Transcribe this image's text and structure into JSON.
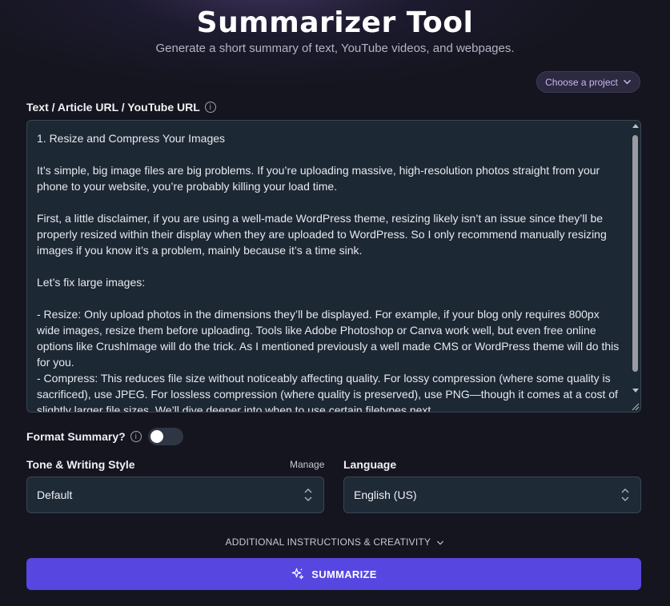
{
  "header": {
    "title": "Summarizer Tool",
    "subtitle": "Generate a short summary of text, YouTube videos, and webpages."
  },
  "project": {
    "label": "Choose a project",
    "icon": "chevron-down-icon"
  },
  "input": {
    "label": "Text / Article URL / YouTube URL",
    "info_icon": "info-icon",
    "value": "1. Resize and Compress Your Images\n\nIt’s simple, big image files are big problems. If you’re uploading massive, high-resolution photos straight from your phone to your website, you’re probably killing your load time.\n\nFirst, a little disclaimer, if you are using a well-made WordPress theme, resizing likely isn’t an issue since they’ll be properly resized within their display when they are uploaded to WordPress. So I only recommend manually resizing images if you know it’s a problem, mainly because it’s a time sink.\n\nLet’s fix large images:\n\n- Resize: Only upload photos in the dimensions they’ll be displayed. For example, if your blog only requires 800px wide images, resize them before uploading. Tools like Adobe Photoshop or Canva work well, but even free online options like CrushImage will do the trick. As I mentioned previously a well made CMS or WordPress theme will do this for you.\n- Compress: This reduces file size without noticeably affecting quality. For lossy compression (where some quality is sacrificed), use JPEG. For lossless compression (where quality is preserved), use PNG—though it comes at a cost of slightly larger file sizes. We’ll dive deeper into when to use certain filetypes next."
  },
  "format": {
    "label": "Format Summary?",
    "enabled": false
  },
  "tone": {
    "label": "Tone & Writing Style",
    "manage_label": "Manage",
    "value": "Default"
  },
  "language": {
    "label": "Language",
    "value": "English (US)"
  },
  "additional": {
    "label": "ADDITIONAL INSTRUCTIONS & CREATIVITY",
    "icon": "chevron-down-icon"
  },
  "action": {
    "label": "SUMMARIZE",
    "icon": "sparkle-icon"
  },
  "colors": {
    "accent": "#5747e0",
    "project_text": "#c8b8f0"
  }
}
